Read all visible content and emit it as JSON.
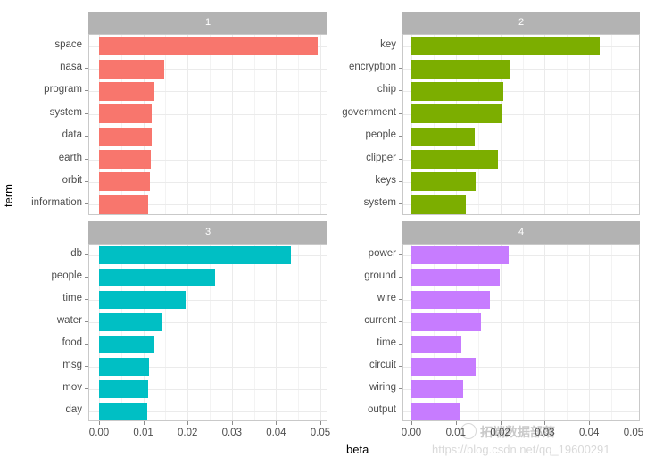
{
  "chart_data": {
    "type": "bar",
    "title": "",
    "xlabel": "beta",
    "ylabel": "term",
    "orientation": "horizontal",
    "faceted": true,
    "facet_variable": "topic",
    "xlim": [
      0,
      0.05
    ],
    "x_ticks": [
      "0.00",
      "0.01",
      "0.02",
      "0.03",
      "0.04",
      "0.05"
    ],
    "x_tick_values": [
      0.0,
      0.01,
      0.02,
      0.03,
      0.04,
      0.05
    ],
    "grid": true,
    "legend": "none",
    "panels": [
      {
        "label": "1",
        "color": "#F8766D",
        "categories": [
          "space",
          "nasa",
          "program",
          "system",
          "data",
          "earth",
          "orbit",
          "information"
        ],
        "values": [
          0.0493,
          0.0147,
          0.0126,
          0.0119,
          0.0118,
          0.0116,
          0.0115,
          0.011
        ]
      },
      {
        "label": "2",
        "color": "#7CAE00",
        "categories": [
          "key",
          "encryption",
          "chip",
          "government",
          "people",
          "clipper",
          "keys",
          "system"
        ],
        "values": [
          0.0424,
          0.0223,
          0.0207,
          0.0203,
          0.0142,
          0.0194,
          0.0145,
          0.0123
        ]
      },
      {
        "label": "3",
        "color": "#00BFC4",
        "categories": [
          "db",
          "people",
          "time",
          "water",
          "food",
          "msg",
          "mov",
          "day"
        ],
        "values": [
          0.0434,
          0.0263,
          0.0196,
          0.0141,
          0.0125,
          0.0113,
          0.011,
          0.0108
        ]
      },
      {
        "label": "4",
        "color": "#C77CFF",
        "categories": [
          "power",
          "ground",
          "wire",
          "current",
          "time",
          "circuit",
          "wiring",
          "output"
        ],
        "values": [
          0.0218,
          0.0198,
          0.0177,
          0.0157,
          0.0112,
          0.0144,
          0.0117,
          0.011
        ]
      }
    ]
  },
  "watermark": {
    "url": "https://blog.csdn.net/qq_19600291",
    "brand": "拓端数据部落"
  }
}
